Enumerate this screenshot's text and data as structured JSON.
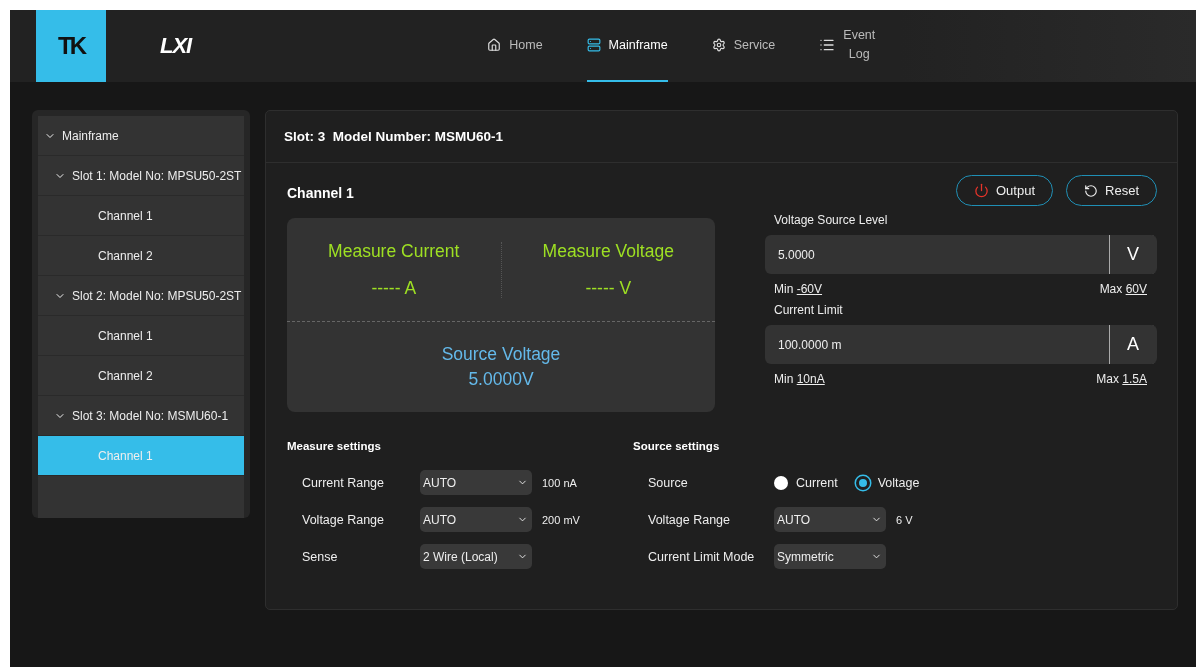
{
  "header": {
    "logo": "TK",
    "brand": "LXI",
    "nav": [
      {
        "label": "Home",
        "kind": "home",
        "selected": false
      },
      {
        "label": "Mainframe",
        "kind": "server",
        "selected": true
      },
      {
        "label": "Service",
        "kind": "gear",
        "selected": false
      },
      {
        "label": "Event Log",
        "kind": "list",
        "selected": false
      }
    ]
  },
  "tree": [
    {
      "label": "Mainframe",
      "expanded": true,
      "selected": false,
      "children": [
        {
          "label": "Slot 1: Model No: MPSU50-2ST",
          "expanded": true,
          "selected": false,
          "children": [
            {
              "label": "Channel 1",
              "selected": false
            },
            {
              "label": "Channel 2",
              "selected": false
            }
          ]
        },
        {
          "label": "Slot 2: Model No: MPSU50-2ST",
          "expanded": true,
          "selected": false,
          "children": [
            {
              "label": "Channel 1",
              "selected": false
            },
            {
              "label": "Channel 2",
              "selected": false
            }
          ]
        },
        {
          "label": "Slot 3: Model No: MSMU60-1",
          "expanded": true,
          "selected": false,
          "children": [
            {
              "label": "Channel 1",
              "selected": true
            }
          ]
        }
      ]
    }
  ],
  "panel": {
    "title": "Slot: 3  Model Number: MSMU60-1",
    "channel": "Channel 1",
    "buttons": [
      {
        "label": "Output",
        "kind": "power"
      },
      {
        "label": "Reset",
        "kind": "reset"
      }
    ],
    "readout": {
      "measures": [
        {
          "label": "Measure Current",
          "value": "----- A"
        },
        {
          "label": "Measure Voltage",
          "value": "----- V"
        }
      ],
      "source": {
        "label": "Source Voltage",
        "value": "5.0000V"
      }
    },
    "levels": [
      {
        "label": "Voltage Source Level",
        "value": "5.0000",
        "unit": "V",
        "min_label": "Min",
        "min": "-60V",
        "max_label": "Max",
        "max": "60V"
      },
      {
        "label": "Current Limit",
        "value": "100.0000 m",
        "unit": "A",
        "min_label": "Min",
        "min": "10nA",
        "max_label": "Max",
        "max": "1.5A"
      }
    ],
    "measure_settings": {
      "title": "Measure settings",
      "rows": [
        {
          "kind": "select",
          "label": "Current Range",
          "value": "AUTO",
          "note": "100 nA"
        },
        {
          "kind": "select",
          "label": "Voltage Range",
          "value": "AUTO",
          "note": "200 mV"
        },
        {
          "kind": "select",
          "label": "Sense",
          "value": "2 Wire (Local)"
        }
      ]
    },
    "source_settings": {
      "title": "Source settings",
      "rows": [
        {
          "kind": "radio",
          "label": "Source",
          "options": [
            {
              "label": "Current",
              "selected": false
            },
            {
              "label": "Voltage",
              "selected": true
            }
          ]
        },
        {
          "kind": "select",
          "label": "Voltage Range",
          "value": "AUTO",
          "note": "6 V"
        },
        {
          "kind": "select",
          "label": "Current Limit Mode",
          "value": "Symmetric"
        }
      ]
    }
  }
}
